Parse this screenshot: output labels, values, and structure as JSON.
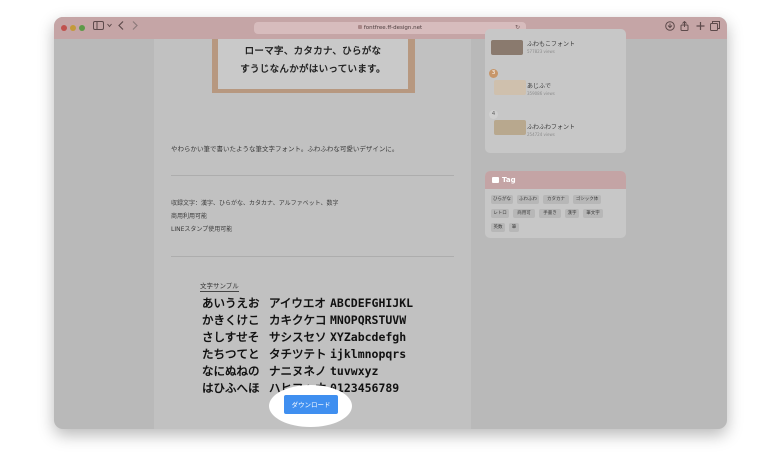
{
  "browser": {
    "url": "fontfree.ff-design.net",
    "icons": {
      "sidebar": "sidebar-icon",
      "back": "chevron-left-icon",
      "forward": "chevron-right-icon",
      "reload": "reload-icon",
      "download": "download-icon",
      "share": "share-icon",
      "new_tab": "plus-icon",
      "tabs": "tabs-overview-icon"
    }
  },
  "article": {
    "hero_lines": [
      "ローマ字、カタカナ、ひらがな",
      "すうじなんかがはいっています。"
    ],
    "description": "やわらかい筆で書いたような筆文字フォント。ふわふわな可愛いデザインに。",
    "info": [
      "収録文字：漢字、ひらがな、カタカナ、アルファベット、数字",
      "商用利用可能",
      "LINEスタンプ使用可能"
    ],
    "sample_title": "文字サンプル",
    "sample_rows": [
      [
        "あいうえお",
        "アイウエオ",
        "ABCDEFGHIJKL"
      ],
      [
        "かきくけこ",
        "カキクケコ",
        "MNOPQRSTUVW"
      ],
      [
        "さしすせそ",
        "サシスセソ",
        "XYZabcdefgh"
      ],
      [
        "たちつてと",
        "タチツテト",
        "ijklmnopqrs"
      ],
      [
        "なにぬねの",
        "ナニヌネノ",
        "tuvwxyz"
      ],
      [
        "はひふへほ",
        "ハヒフヘホ",
        "0123456789"
      ]
    ],
    "download_label": "ダウンロード"
  },
  "sidebar": {
    "ranking": [
      {
        "rank": "",
        "title": "ふわもこフォント",
        "views": "577823 views"
      },
      {
        "rank": "3",
        "title": "あじふで",
        "views": "359086 views"
      },
      {
        "rank": "4",
        "title": "ふわふわフォント",
        "views": "254724 views"
      }
    ],
    "tag_heading": "Tag",
    "tags": [
      "ひらがな",
      "ふわふわ",
      "カタカナ",
      "ゴシック体",
      "レトロ",
      "商用可",
      "手書き",
      "漢字",
      "筆文字",
      "英数",
      "筆"
    ]
  },
  "colors": {
    "titlebar": "#c5a5a6",
    "download_button": "#3f8ff0",
    "tag_header": "#c4a4a5",
    "overlay_gray": "#b9b9b9"
  }
}
